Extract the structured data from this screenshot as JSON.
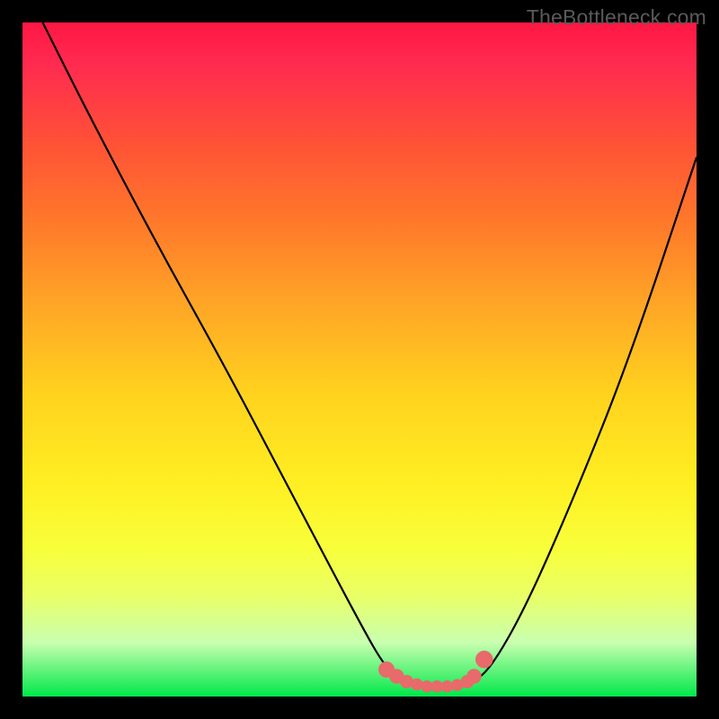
{
  "watermark": "TheBottleneck.com",
  "chart_data": {
    "type": "line",
    "title": "",
    "xlabel": "",
    "ylabel": "",
    "xlim": [
      0,
      100
    ],
    "ylim": [
      0,
      100
    ],
    "series": [
      {
        "name": "curve",
        "color": "#000000",
        "x": [
          3,
          10,
          20,
          30,
          40,
          50,
          54,
          57,
          61,
          64,
          67,
          70,
          75,
          82,
          90,
          100
        ],
        "y": [
          100,
          86,
          67,
          49,
          30,
          11,
          4,
          2,
          1.5,
          1.5,
          2,
          5,
          14,
          30,
          50,
          80
        ]
      }
    ],
    "markers": [
      {
        "name": "left-curl-start",
        "x": 54,
        "y": 4,
        "r": 1.2,
        "color": "#e86a6a"
      },
      {
        "name": "left-curl-a",
        "x": 55.5,
        "y": 3,
        "r": 1.1,
        "color": "#e86a6a"
      },
      {
        "name": "left-curl-b",
        "x": 57,
        "y": 2.2,
        "r": 1.0,
        "color": "#e86a6a"
      },
      {
        "name": "bottom-a",
        "x": 58.5,
        "y": 1.8,
        "r": 0.9,
        "color": "#e86a6a"
      },
      {
        "name": "bottom-b",
        "x": 60,
        "y": 1.5,
        "r": 0.9,
        "color": "#e86a6a"
      },
      {
        "name": "bottom-c",
        "x": 61.5,
        "y": 1.5,
        "r": 0.9,
        "color": "#e86a6a"
      },
      {
        "name": "bottom-d",
        "x": 63,
        "y": 1.5,
        "r": 0.9,
        "color": "#e86a6a"
      },
      {
        "name": "bottom-e",
        "x": 64.5,
        "y": 1.7,
        "r": 0.9,
        "color": "#e86a6a"
      },
      {
        "name": "right-curl-a",
        "x": 66,
        "y": 2.2,
        "r": 1.0,
        "color": "#e86a6a"
      },
      {
        "name": "right-curl-b",
        "x": 67,
        "y": 3.0,
        "r": 1.1,
        "color": "#e86a6a"
      },
      {
        "name": "right-curl-end",
        "x": 68.5,
        "y": 5.5,
        "r": 1.3,
        "color": "#e86a6a"
      }
    ]
  }
}
